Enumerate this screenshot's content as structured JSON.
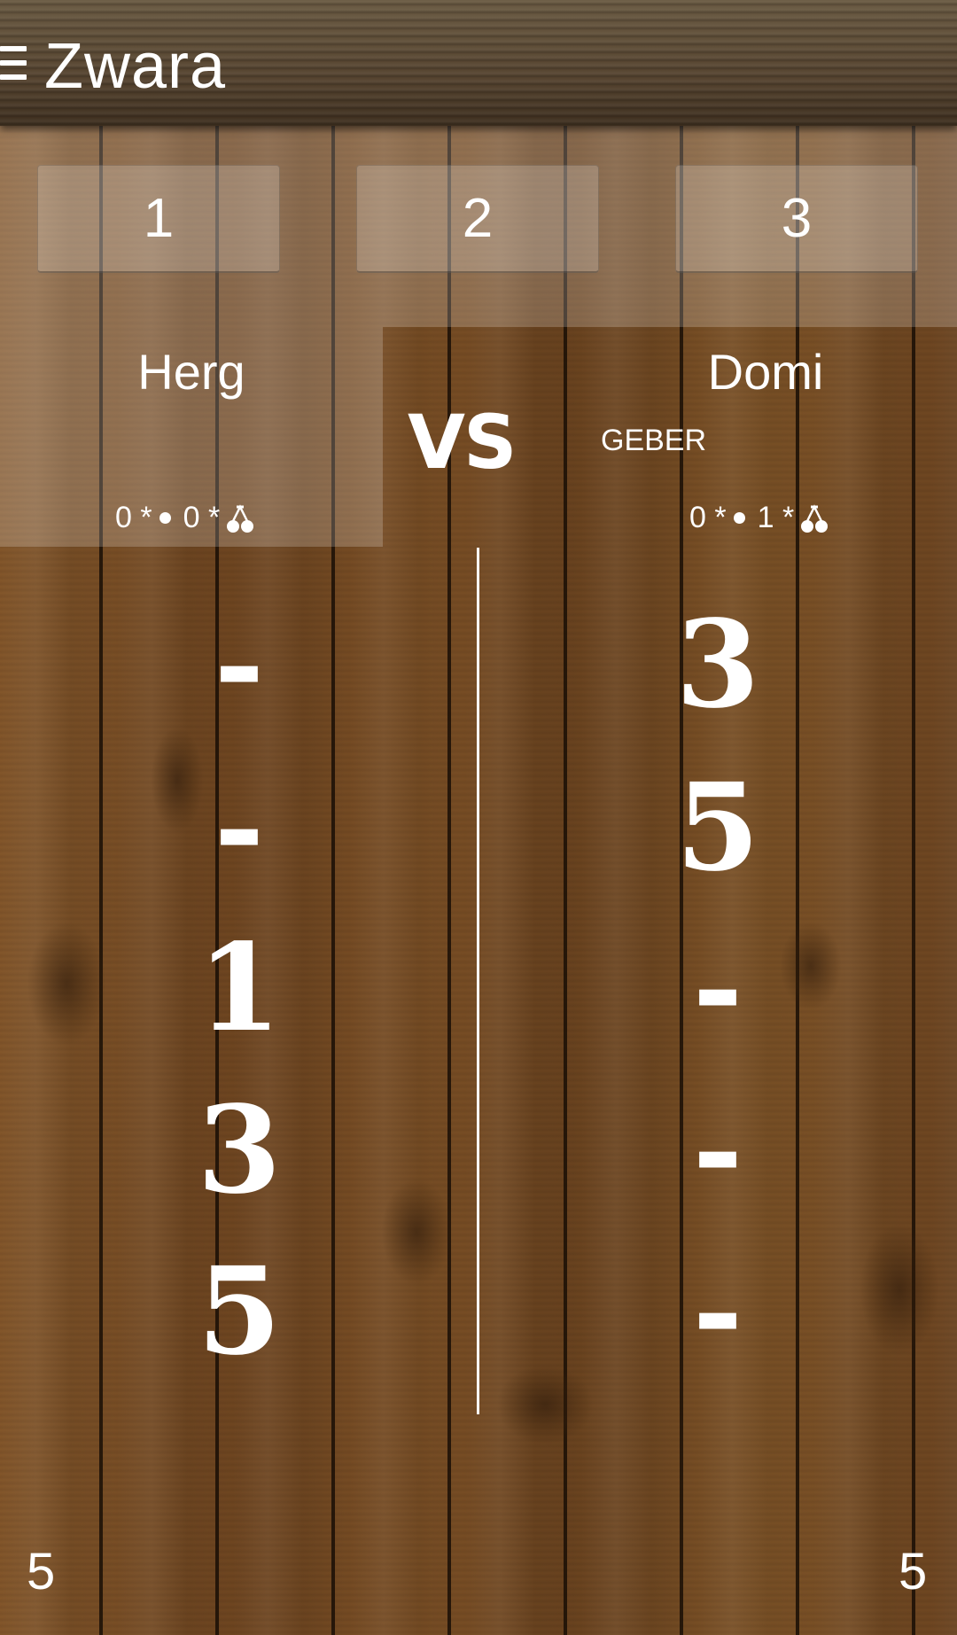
{
  "app": {
    "title": "Zwara"
  },
  "rounds": [
    {
      "label": "1"
    },
    {
      "label": "2"
    },
    {
      "label": "3"
    }
  ],
  "match": {
    "vs_label": "VS",
    "left_player": {
      "name": "Herg",
      "stat_dot_count": "0 *",
      "stat_cherry_count": "0 *",
      "scores": [
        "-",
        "-",
        "1",
        "3",
        "5"
      ],
      "total": "5"
    },
    "right_player": {
      "name": "Domi",
      "role_label": "GEBER",
      "stat_dot_count": "0 *",
      "stat_cherry_count": "1 *",
      "scores": [
        "3",
        "5",
        "-",
        "-",
        "-"
      ],
      "total": "5"
    }
  },
  "icons": {
    "menu": "menu-icon",
    "dot": "dot-icon",
    "cherry": "cherry-icon"
  },
  "colors": {
    "text": "#ffffff",
    "wood": "#7a4f24"
  }
}
